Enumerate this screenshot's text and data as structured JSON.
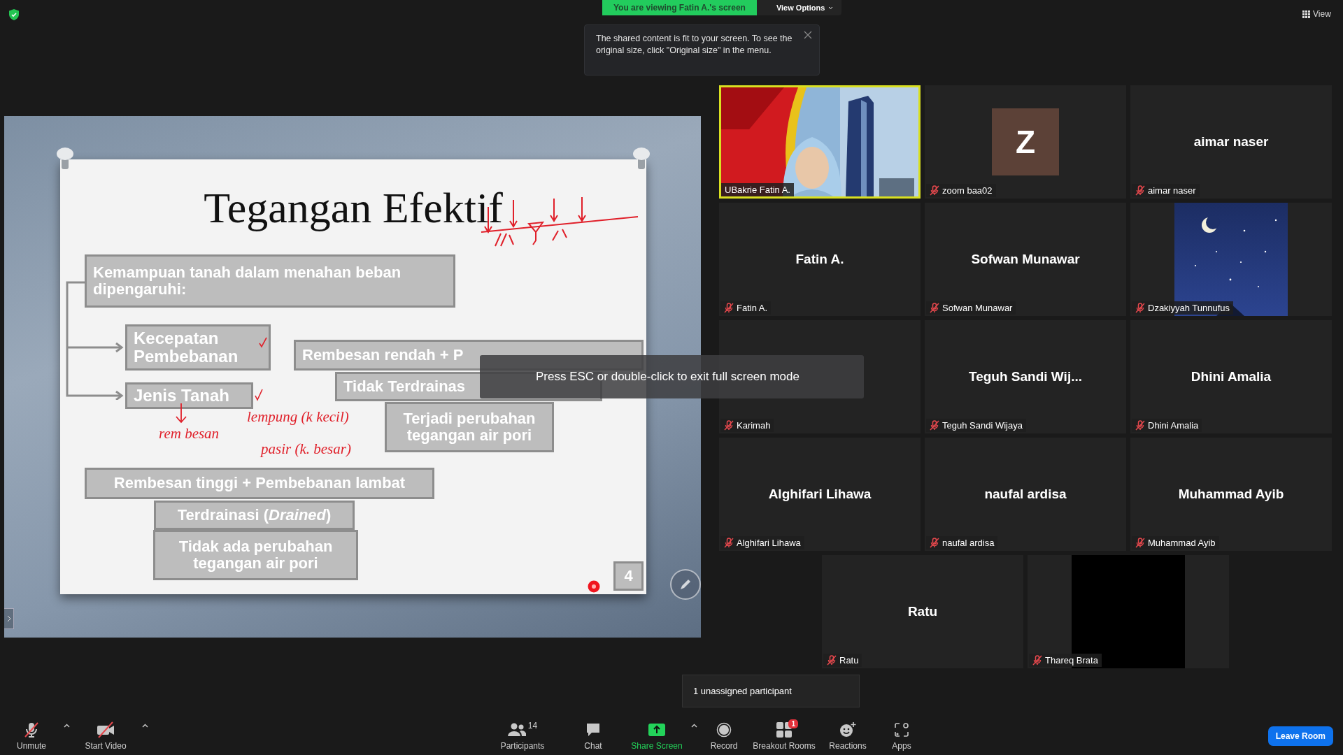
{
  "share_banner": {
    "text": "You are viewing Fatin A.'s screen",
    "view_options": "View Options"
  },
  "tooltip": {
    "text": "The shared content is fit to your screen. To see the original size, click \"Original size\" in the menu."
  },
  "view_button": "View",
  "slide": {
    "title": "Tegangan Efektif",
    "boxes": [
      "Kemampuan tanah dalam menahan beban dipengaruhi:",
      "Kecepatan Pembebanan",
      "Rembesan rendah + P",
      "Tidak Terdrainas",
      "Jenis Tanah",
      "Terjadi perubahan tegangan air pori",
      "Rembesan tinggi + Pembebanan lambat",
      "Terdrainasi (*Drained*)",
      "Tidak ada perubahan tegangan air pori"
    ],
    "ink_notes": [
      "rem besan",
      "lempung (k kecil)",
      "pasir (k. besar)"
    ],
    "page_number": "4"
  },
  "fullscreen_hint": "Press ESC or double-click to exit full screen mode",
  "gallery": [
    {
      "kind": "video",
      "name": "UBakrie Fatin A.",
      "muted": false,
      "speaking": true
    },
    {
      "kind": "avatar",
      "initial": "Z",
      "name": "zoom baa02",
      "muted": true,
      "speaking": false
    },
    {
      "kind": "name",
      "display_name": "aimar naser",
      "name": "aimar naser",
      "muted": true,
      "speaking": false
    },
    {
      "kind": "name",
      "display_name": "Fatin A.",
      "name": "Fatin A.",
      "muted": true,
      "speaking": false
    },
    {
      "kind": "name",
      "display_name": "Sofwan Munawar",
      "name": "Sofwan Munawar",
      "muted": true,
      "speaking": false
    },
    {
      "kind": "picture",
      "name": "Dzakiyyah Tunnufus",
      "muted": true,
      "speaking": false
    },
    {
      "kind": "covered",
      "name": "Karimah",
      "muted": true,
      "speaking": false
    },
    {
      "kind": "name",
      "display_name": "Teguh Sandi Wij...",
      "name": "Teguh Sandi Wijaya",
      "muted": true,
      "speaking": false
    },
    {
      "kind": "name",
      "display_name": "Dhini Amalia",
      "name": "Dhini Amalia",
      "muted": true,
      "speaking": false
    },
    {
      "kind": "name",
      "display_name": "Alghifari Lihawa",
      "name": "Alghifari Lihawa",
      "muted": true,
      "speaking": false
    },
    {
      "kind": "name",
      "display_name": "naufal ardisa",
      "name": "naufal ardisa",
      "muted": true,
      "speaking": false
    },
    {
      "kind": "name",
      "display_name": "Muhammad Ayib",
      "name": "Muhammad Ayib",
      "muted": true,
      "speaking": false
    },
    {
      "kind": "name",
      "display_name": "Ratu",
      "name": "Ratu",
      "muted": true,
      "speaking": false
    },
    {
      "kind": "blank",
      "name": "Thareq Brata",
      "muted": true,
      "speaking": false
    }
  ],
  "breakout_popup": "1 unassigned participant",
  "toolbar": [
    {
      "kind": "mic",
      "label": "Unmute",
      "has_menu": true
    },
    {
      "kind": "video",
      "label": "Start Video",
      "has_menu": true
    },
    {
      "kind": "participants",
      "label": "Participants",
      "count": "14",
      "has_menu": false
    },
    {
      "kind": "chat",
      "label": "Chat",
      "has_menu": false
    },
    {
      "kind": "share",
      "label": "Share Screen",
      "has_menu": true
    },
    {
      "kind": "record",
      "label": "Record",
      "has_menu": false
    },
    {
      "kind": "breakout",
      "label": "Breakout Rooms",
      "badge": "1",
      "has_menu": false
    },
    {
      "kind": "reactions",
      "label": "Reactions",
      "has_menu": false
    },
    {
      "kind": "apps",
      "label": "Apps",
      "has_menu": false
    }
  ],
  "leave_button": "Leave Room"
}
